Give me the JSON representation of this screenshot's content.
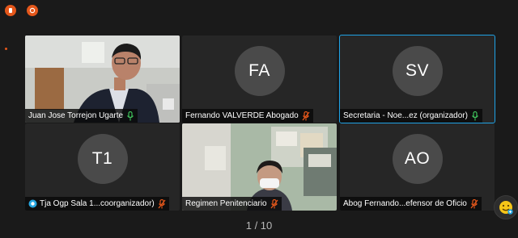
{
  "pager": {
    "text": "1 / 10"
  },
  "tiles": [
    {
      "name": "Juan Jose Torrejon Ugarte",
      "mic": "on"
    },
    {
      "name": "Fernando VALVERDE Abogado",
      "initials": "FA",
      "mic": "off"
    },
    {
      "name": "Secretaria - Noe...ez (organizador)",
      "initials": "SV",
      "mic": "on"
    },
    {
      "name": "Tja Ogp Sala 1...coorganizador)",
      "initials": "T1",
      "mic": "off"
    },
    {
      "name": "Regimen Penitenciario",
      "mic": "off"
    },
    {
      "name": "Abog Fernando...efensor de Oficio",
      "initials": "AO",
      "mic": "off"
    }
  ],
  "colors": {
    "mic_on": "#3fbf5a",
    "mic_off": "#e4571b",
    "active_border": "#1fa3e6"
  },
  "icons": [
    "record-icon",
    "stop-icon",
    "mic-icon",
    "mic-off-icon",
    "emoji-icon"
  ]
}
